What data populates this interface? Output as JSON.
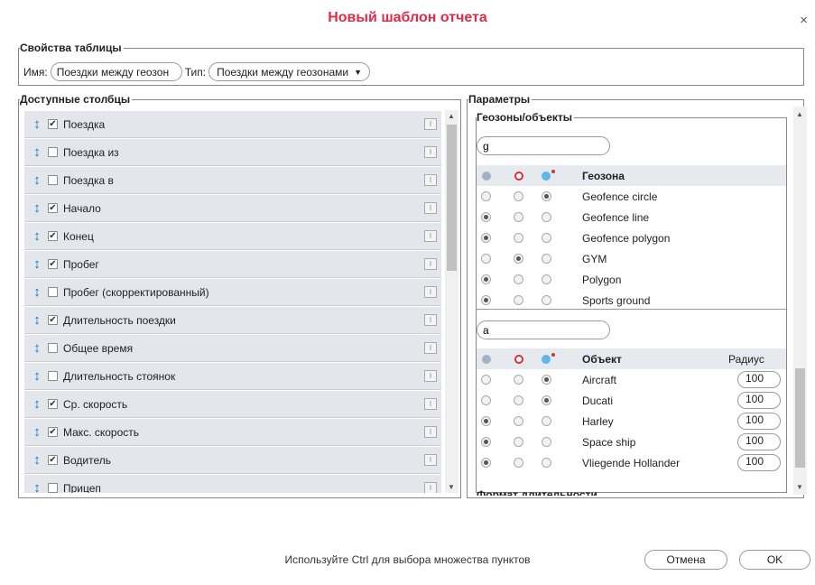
{
  "dialog": {
    "title": "Новый шаблон отчета",
    "close_glyph": "×"
  },
  "table_props": {
    "legend": "Свойства таблицы",
    "name_label": "Имя:",
    "name_value": "Поездки между геозон",
    "type_label": "Тип:",
    "type_value": "Поездки между геозонами",
    "type_arrow": "▼"
  },
  "columns": {
    "legend": "Доступные столбцы",
    "items": [
      {
        "label": "Поездка",
        "checked": "✔"
      },
      {
        "label": "Поездка из",
        "checked": ""
      },
      {
        "label": "Поездка в",
        "checked": ""
      },
      {
        "label": "Начало",
        "checked": "✔"
      },
      {
        "label": "Конец",
        "checked": "✔"
      },
      {
        "label": "Пробег",
        "checked": "✔"
      },
      {
        "label": "Пробег (скорректированный)",
        "checked": ""
      },
      {
        "label": "Длительность поездки",
        "checked": "✔"
      },
      {
        "label": "Общее время",
        "checked": ""
      },
      {
        "label": "Длительность стоянок",
        "checked": ""
      },
      {
        "label": "Ср. скорость",
        "checked": "✔"
      },
      {
        "label": "Макс. скорость",
        "checked": "✔"
      },
      {
        "label": "Водитель",
        "checked": "✔"
      },
      {
        "label": "Прицеп",
        "checked": ""
      }
    ]
  },
  "params": {
    "legend": "Параметры",
    "geo_legend": "Геозоны/объекты",
    "geo_filter": "g",
    "geo_header": "Геозона",
    "geozones": [
      {
        "name": "Geofence circle",
        "sel": 2
      },
      {
        "name": "Geofence line",
        "sel": 0
      },
      {
        "name": "Geofence polygon",
        "sel": 0
      },
      {
        "name": "GYM",
        "sel": 1
      },
      {
        "name": "Polygon",
        "sel": 0
      },
      {
        "name": "Sports ground",
        "sel": 0
      }
    ],
    "obj_filter": "a",
    "obj_header": "Объект",
    "radius_header": "Радиус",
    "objects": [
      {
        "name": "Aircraft",
        "sel": 2,
        "radius": "100"
      },
      {
        "name": "Ducati",
        "sel": 2,
        "radius": "100"
      },
      {
        "name": "Harley",
        "sel": 0,
        "radius": "100"
      },
      {
        "name": "Space ship",
        "sel": 0,
        "radius": "100"
      },
      {
        "name": "Vliegende Hollander",
        "sel": 0,
        "radius": "100"
      }
    ],
    "next_section": "Формат длительности"
  },
  "footer": {
    "hint": "Используйте Ctrl для выбора множества пунктов",
    "cancel": "Отмена",
    "ok": "OK"
  },
  "colors": {
    "title": "#e32b47",
    "drag": "#1a72c8",
    "row_bg": "#e3e7eb",
    "icon_grey": "#9fb3c4",
    "icon_red": "#d6323a",
    "icon_blue": "#5bb8e8"
  }
}
